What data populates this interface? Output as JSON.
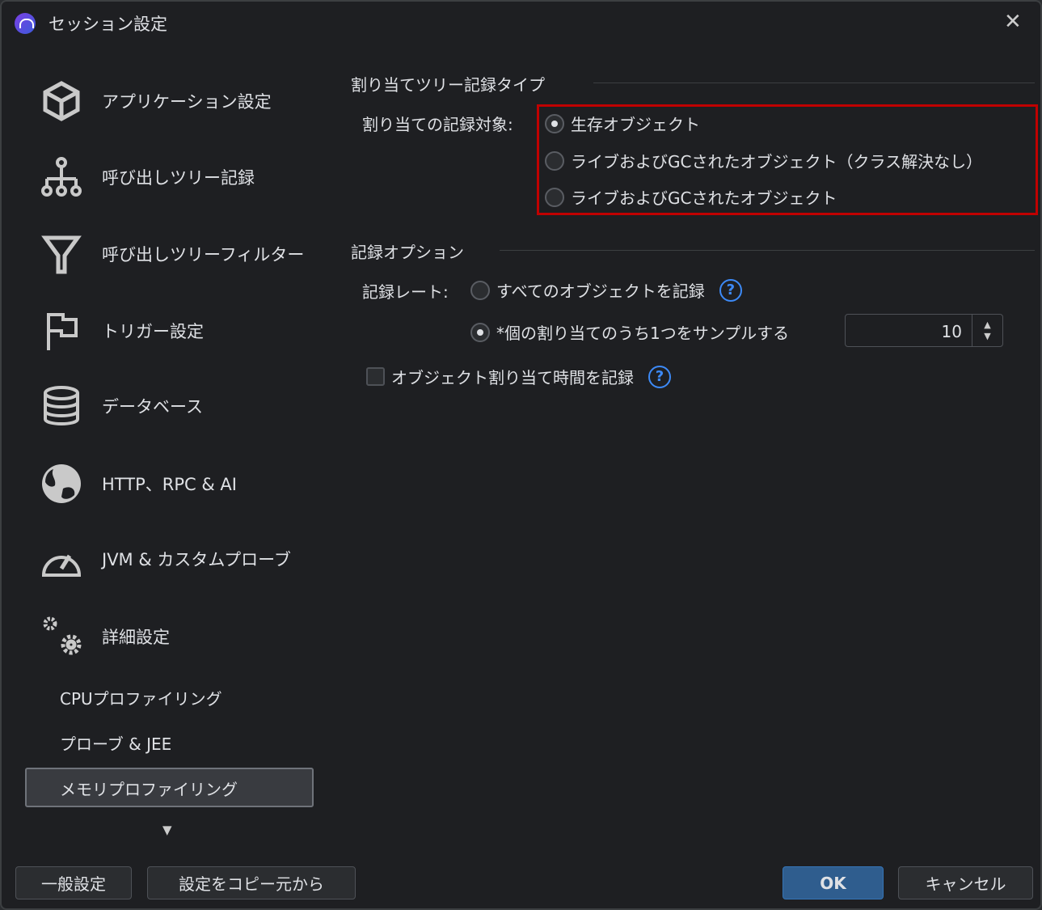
{
  "window": {
    "title": "セッション設定",
    "close": "✕"
  },
  "sidebar": {
    "items": [
      {
        "label": "アプリケーション設定",
        "icon": "cube-icon"
      },
      {
        "label": "呼び出しツリー記録",
        "icon": "tree-icon"
      },
      {
        "label": "呼び出しツリーフィルター",
        "icon": "filter-icon"
      },
      {
        "label": "トリガー設定",
        "icon": "flag-icon"
      },
      {
        "label": "データベース",
        "icon": "database-icon"
      },
      {
        "label": "HTTP、RPC & AI",
        "icon": "globe-icon"
      },
      {
        "label": "JVM & カスタムプローブ",
        "icon": "gauge-icon"
      },
      {
        "label": "詳細設定",
        "icon": "gears-icon"
      }
    ],
    "subitems": [
      {
        "label": "CPUプロファイリング"
      },
      {
        "label": "プローブ & JEE"
      },
      {
        "label": "メモリプロファイリング",
        "selected": true
      }
    ],
    "more": "▼"
  },
  "alloc": {
    "section": "割り当てツリー記録タイプ",
    "label": "割り当ての記録対象:",
    "options": [
      {
        "label": "生存オブジェクト",
        "checked": true
      },
      {
        "label": "ライブおよびGCされたオブジェクト（クラス解決なし）",
        "checked": false
      },
      {
        "label": "ライブおよびGCされたオブジェクト",
        "checked": false
      }
    ]
  },
  "rec": {
    "section": "記録オプション",
    "rate_label": "記録レート:",
    "opt_all": "すべてのオブジェクトを記録",
    "opt_sample": "*個の割り当てのうち1つをサンプルする",
    "sample_value": "10",
    "time_label": "オブジェクト割り当て時間を記録",
    "time_checked": false,
    "help": "?"
  },
  "footer": {
    "general": "一般設定",
    "copy": "設定をコピー元から",
    "ok": "OK",
    "cancel": "キャンセル"
  },
  "colors": {
    "accent": "#2f5d8e",
    "highlight": "#c00000",
    "help": "#3d8af7"
  }
}
